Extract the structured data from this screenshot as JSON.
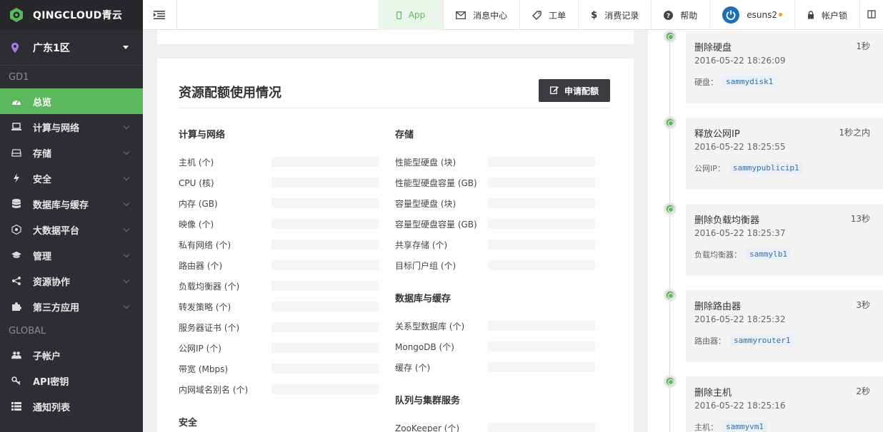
{
  "brand": {
    "logo_text": "QINGCLOUD青云"
  },
  "zone": {
    "label": "广东1区"
  },
  "sidebar": {
    "group_gd1": "GD1",
    "items_gd1": [
      {
        "label": "总览",
        "icon": "gauge-icon"
      },
      {
        "label": "计算与网络",
        "icon": "laptop-icon"
      },
      {
        "label": "存储",
        "icon": "storage-icon"
      },
      {
        "label": "安全",
        "icon": "bolt-icon"
      },
      {
        "label": "数据库与缓存",
        "icon": "database-icon"
      },
      {
        "label": "大数据平台",
        "icon": "bigdata-icon"
      },
      {
        "label": "管理",
        "icon": "graduation-cap-icon"
      },
      {
        "label": "资源协作",
        "icon": "share-icon"
      },
      {
        "label": "第三方应用",
        "icon": "puzzle-icon"
      }
    ],
    "group_global": "GLOBAL",
    "items_global": [
      {
        "label": "子帐户",
        "icon": "users-icon"
      },
      {
        "label": "API密钥",
        "icon": "key-icon"
      },
      {
        "label": "通知列表",
        "icon": "list-icon"
      }
    ]
  },
  "topbar": {
    "app": "App",
    "messages": "消息中心",
    "tickets": "工单",
    "billing": "消费记录",
    "help": "帮助",
    "user": "esuns2",
    "lock": "帐户锁"
  },
  "quota": {
    "title": "资源配额使用情况",
    "apply_button": "申请配额",
    "compute": {
      "title": "计算与网络",
      "items": [
        "主机 (个)",
        "CPU (核)",
        "内存 (GB)",
        "映像 (个)",
        "私有网络 (个)",
        "路由器 (个)",
        "负载均衡器 (个)",
        "转发策略 (个)",
        "服务器证书 (个)",
        "公网IP (个)",
        "带宽 (Mbps)",
        "内网域名别名 (个)"
      ]
    },
    "security": {
      "title": "安全"
    },
    "storage": {
      "title": "存储",
      "items": [
        "性能型硬盘 (块)",
        "性能型硬盘容量 (GB)",
        "容量型硬盘 (块)",
        "容量型硬盘容量 (GB)",
        "共享存储 (个)",
        "目标门户组 (个)"
      ]
    },
    "database": {
      "title": "数据库与缓存",
      "items": [
        "关系型数据库 (个)",
        "MongoDB (个)",
        "缓存 (个)"
      ]
    },
    "queue": {
      "title": "队列与集群服务",
      "items": [
        "ZooKeeper (个)"
      ]
    }
  },
  "timeline": [
    {
      "title": "删除硬盘",
      "ago": "1秒",
      "time": "2016-05-22 18:26:09",
      "res_label": "硬盘：",
      "res_tag": "sammydisk1"
    },
    {
      "title": "释放公网IP",
      "ago": "1秒之内",
      "time": "2016-05-22 18:25:55",
      "res_label": "公网IP：",
      "res_tag": "sammypublicip1"
    },
    {
      "title": "删除负载均衡器",
      "ago": "13秒",
      "time": "2016-05-22 18:25:37",
      "res_label": "负载均衡器：",
      "res_tag": "sammylb1"
    },
    {
      "title": "删除路由器",
      "ago": "3秒",
      "time": "2016-05-22 18:25:32",
      "res_label": "路由器：",
      "res_tag": "sammyrouter1"
    },
    {
      "title": "删除主机",
      "ago": "2秒",
      "time": "2016-05-22 18:25:16",
      "res_label": "主机：",
      "res_tag": "sammyvm1"
    }
  ],
  "colors": {
    "accent": "#5cb85c",
    "sidebar": "#2d2e33",
    "button": "#3b3c41"
  }
}
